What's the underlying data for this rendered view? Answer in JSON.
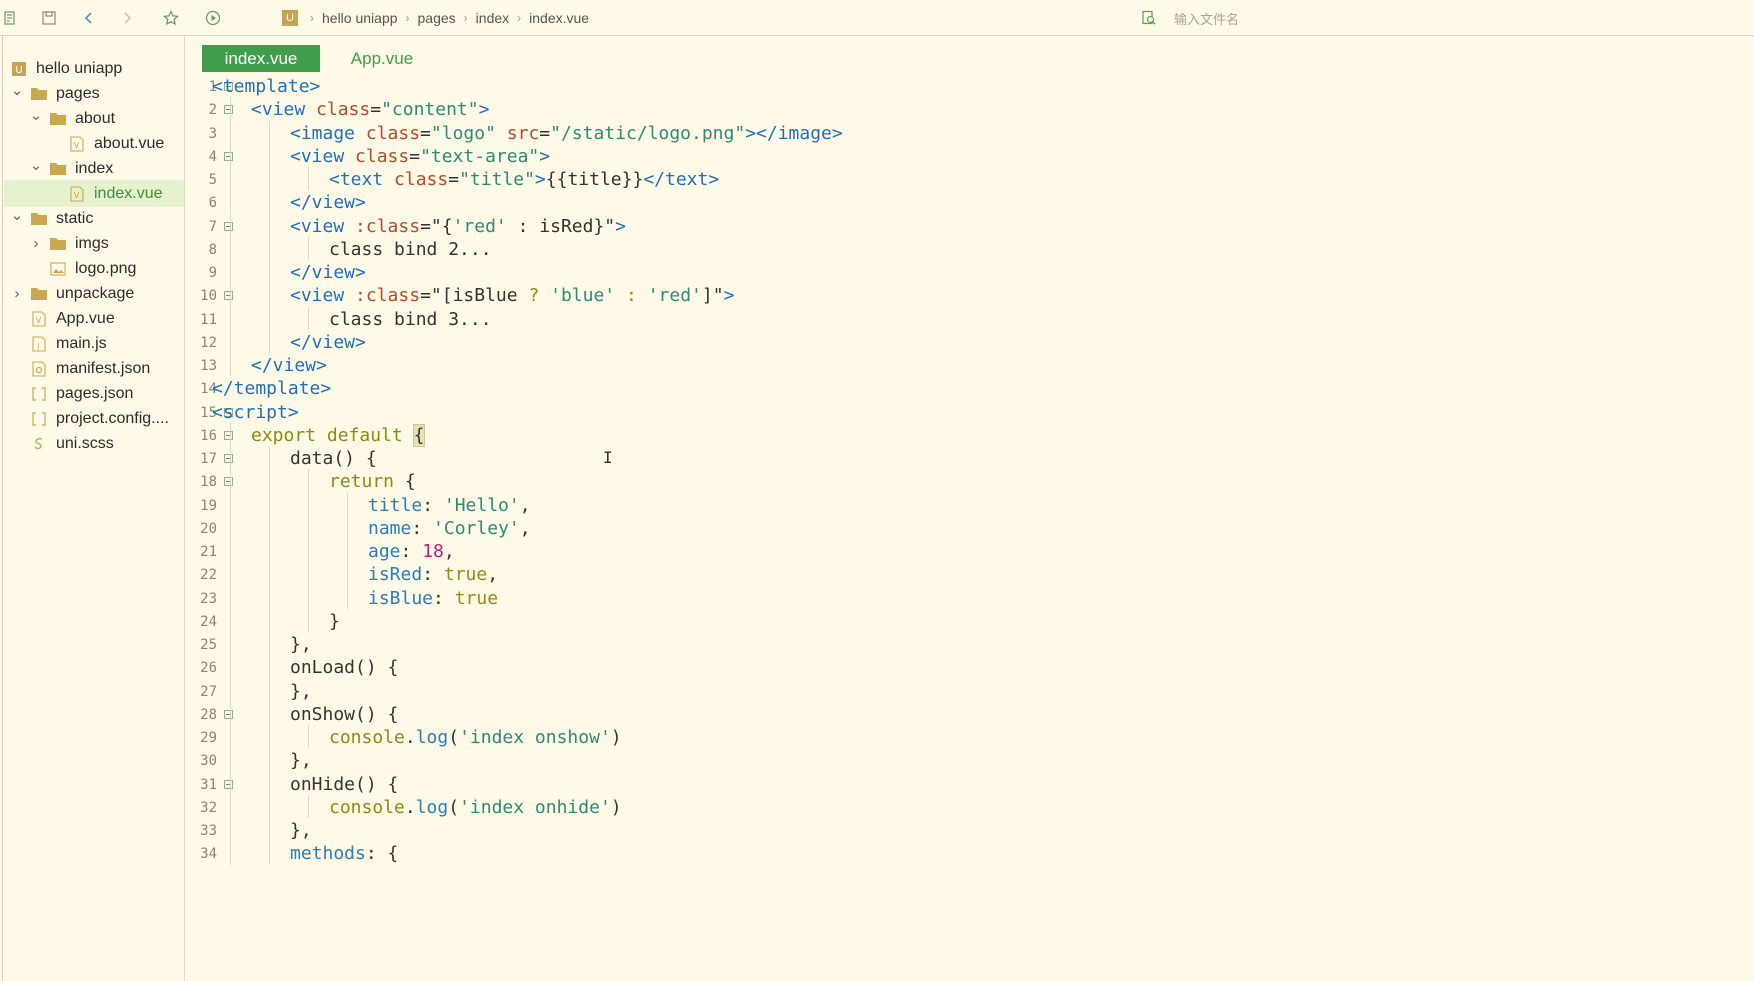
{
  "toolbar": {
    "icons": [
      "app-menu-icon",
      "save-icon",
      "back-icon",
      "forward-icon",
      "star-icon",
      "run-icon"
    ],
    "breadcrumb": {
      "project_icon": "U",
      "items": [
        "hello uniapp",
        "pages",
        "index",
        "index.vue"
      ]
    },
    "file_search": {
      "placeholder": "输入文件名",
      "value": ""
    }
  },
  "sidebar": {
    "items": [
      {
        "label": "hello uniapp",
        "type": "project",
        "level": 0,
        "expanded": true,
        "icon": "project-icon"
      },
      {
        "label": "pages",
        "type": "folder",
        "level": 0,
        "expanded": true,
        "icon": "folder-icon"
      },
      {
        "label": "about",
        "type": "folder",
        "level": 1,
        "expanded": true,
        "icon": "folder-icon"
      },
      {
        "label": "about.vue",
        "type": "vue",
        "level": 2,
        "icon": "vue-file-icon"
      },
      {
        "label": "index",
        "type": "folder",
        "level": 1,
        "expanded": true,
        "icon": "folder-icon"
      },
      {
        "label": "index.vue",
        "type": "vue",
        "level": 2,
        "icon": "vue-file-icon",
        "selected": true
      },
      {
        "label": "static",
        "type": "folder",
        "level": 0,
        "expanded": true,
        "icon": "folder-icon"
      },
      {
        "label": "imgs",
        "type": "folder",
        "level": 1,
        "expanded": false,
        "icon": "folder-icon"
      },
      {
        "label": "logo.png",
        "type": "image",
        "level": 1,
        "icon": "image-file-icon"
      },
      {
        "label": "unpackage",
        "type": "folder",
        "level": 0,
        "expanded": false,
        "icon": "folder-icon"
      },
      {
        "label": "App.vue",
        "type": "vue",
        "level": 0,
        "icon": "vue-file-icon"
      },
      {
        "label": "main.js",
        "type": "js",
        "level": 0,
        "icon": "js-file-icon"
      },
      {
        "label": "manifest.json",
        "type": "json",
        "level": 0,
        "icon": "manifest-file-icon"
      },
      {
        "label": "pages.json",
        "type": "json",
        "level": 0,
        "icon": "json-file-icon"
      },
      {
        "label": "project.config....",
        "type": "json",
        "level": 0,
        "icon": "json-file-icon"
      },
      {
        "label": "uni.scss",
        "type": "scss",
        "level": 0,
        "icon": "scss-file-icon"
      }
    ]
  },
  "tabs": [
    {
      "label": "index.vue",
      "active": true
    },
    {
      "label": "App.vue",
      "active": false
    }
  ],
  "editor": {
    "lines": [
      {
        "n": "1",
        "fold": true,
        "indent": 0,
        "tokens": [
          [
            "tag",
            "<template>"
          ]
        ]
      },
      {
        "n": "2",
        "fold": true,
        "indent": 1,
        "tokens": [
          [
            "tag",
            "<view "
          ],
          [
            "attr",
            "class"
          ],
          [
            "punc",
            "="
          ],
          [
            "str",
            "\"content\""
          ],
          [
            "tag",
            ">"
          ]
        ]
      },
      {
        "n": "3",
        "fold": false,
        "indent": 2,
        "tokens": [
          [
            "tag",
            "<image "
          ],
          [
            "attr",
            "class"
          ],
          [
            "punc",
            "="
          ],
          [
            "str",
            "\"logo\""
          ],
          [
            "punc",
            " "
          ],
          [
            "attr",
            "src"
          ],
          [
            "punc",
            "="
          ],
          [
            "str",
            "\"/static/logo.png\""
          ],
          [
            "tag",
            "></image>"
          ]
        ]
      },
      {
        "n": "4",
        "fold": true,
        "indent": 2,
        "tokens": [
          [
            "tag",
            "<view "
          ],
          [
            "attr",
            "class"
          ],
          [
            "punc",
            "="
          ],
          [
            "str",
            "\"text-area\""
          ],
          [
            "tag",
            ">"
          ]
        ]
      },
      {
        "n": "5",
        "fold": false,
        "indent": 3,
        "tokens": [
          [
            "tag",
            "<text "
          ],
          [
            "attr",
            "class"
          ],
          [
            "punc",
            "="
          ],
          [
            "str",
            "\"title\""
          ],
          [
            "tag",
            ">"
          ],
          [
            "punc",
            "{{title}}"
          ],
          [
            "tag",
            "</text>"
          ]
        ]
      },
      {
        "n": "6",
        "fold": false,
        "indent": 2,
        "tokens": [
          [
            "tag",
            "</view>"
          ]
        ]
      },
      {
        "n": "7",
        "fold": true,
        "indent": 2,
        "tokens": [
          [
            "tag",
            "<view "
          ],
          [
            "attr",
            ":class"
          ],
          [
            "punc",
            "=\"{"
          ],
          [
            "str",
            "'red'"
          ],
          [
            "punc",
            " : isRed}\""
          ],
          [
            "tag",
            ">"
          ]
        ]
      },
      {
        "n": "8",
        "fold": false,
        "indent": 3,
        "tokens": [
          [
            "punc",
            "class bind 2..."
          ]
        ]
      },
      {
        "n": "9",
        "fold": false,
        "indent": 2,
        "tokens": [
          [
            "tag",
            "</view>"
          ]
        ]
      },
      {
        "n": "10",
        "fold": true,
        "indent": 2,
        "tokens": [
          [
            "tag",
            "<view "
          ],
          [
            "attr",
            ":class"
          ],
          [
            "punc",
            "=\"[isBlue "
          ],
          [
            "kw",
            "?"
          ],
          [
            "punc",
            " "
          ],
          [
            "str",
            "'blue'"
          ],
          [
            "punc",
            " "
          ],
          [
            "kw",
            ":"
          ],
          [
            "punc",
            " "
          ],
          [
            "str",
            "'red'"
          ],
          [
            "punc",
            "]\""
          ],
          [
            "tag",
            ">"
          ]
        ]
      },
      {
        "n": "11",
        "fold": false,
        "indent": 3,
        "tokens": [
          [
            "punc",
            "class bind 3..."
          ]
        ]
      },
      {
        "n": "12",
        "fold": false,
        "indent": 2,
        "tokens": [
          [
            "tag",
            "</view>"
          ]
        ]
      },
      {
        "n": "13",
        "fold": false,
        "indent": 1,
        "tokens": [
          [
            "tag",
            "</view>"
          ]
        ]
      },
      {
        "n": "14",
        "fold": false,
        "indent": 0,
        "tokens": [
          [
            "tag",
            "</template>"
          ]
        ]
      },
      {
        "n": "15",
        "fold": true,
        "indent": 0,
        "tokens": [
          [
            "tag",
            "<script>"
          ]
        ]
      },
      {
        "n": "16",
        "fold": true,
        "indent": 1,
        "tokens": [
          [
            "kw",
            "export default "
          ],
          [
            "brace",
            "{"
          ]
        ]
      },
      {
        "n": "17",
        "fold": true,
        "indent": 2,
        "tokens": [
          [
            "punc",
            "data() {"
          ]
        ]
      },
      {
        "n": "18",
        "fold": true,
        "indent": 3,
        "tokens": [
          [
            "kw",
            "return"
          ],
          [
            "punc",
            " {"
          ]
        ]
      },
      {
        "n": "19",
        "fold": false,
        "indent": 4,
        "tokens": [
          [
            "prop",
            "title"
          ],
          [
            "punc",
            ": "
          ],
          [
            "str",
            "'Hello'"
          ],
          [
            "punc",
            ","
          ]
        ]
      },
      {
        "n": "20",
        "fold": false,
        "indent": 4,
        "tokens": [
          [
            "prop",
            "name"
          ],
          [
            "punc",
            ": "
          ],
          [
            "str",
            "'Corley'"
          ],
          [
            "punc",
            ","
          ]
        ]
      },
      {
        "n": "21",
        "fold": false,
        "indent": 4,
        "tokens": [
          [
            "prop",
            "age"
          ],
          [
            "punc",
            ": "
          ],
          [
            "num",
            "18"
          ],
          [
            "punc",
            ","
          ]
        ]
      },
      {
        "n": "22",
        "fold": false,
        "indent": 4,
        "tokens": [
          [
            "prop",
            "isRed"
          ],
          [
            "punc",
            ": "
          ],
          [
            "bool",
            "true"
          ],
          [
            "punc",
            ","
          ]
        ]
      },
      {
        "n": "23",
        "fold": false,
        "indent": 4,
        "tokens": [
          [
            "prop",
            "isBlue"
          ],
          [
            "punc",
            ": "
          ],
          [
            "bool",
            "true"
          ]
        ]
      },
      {
        "n": "24",
        "fold": false,
        "indent": 3,
        "tokens": [
          [
            "punc",
            "}"
          ]
        ]
      },
      {
        "n": "25",
        "fold": false,
        "indent": 2,
        "tokens": [
          [
            "punc",
            "},"
          ]
        ]
      },
      {
        "n": "26",
        "fold": false,
        "indent": 2,
        "tokens": [
          [
            "punc",
            "onLoad() {"
          ]
        ]
      },
      {
        "n": "27",
        "fold": false,
        "indent": 2,
        "tokens": [
          [
            "punc",
            "},"
          ]
        ]
      },
      {
        "n": "28",
        "fold": true,
        "indent": 2,
        "tokens": [
          [
            "punc",
            "onShow() {"
          ]
        ]
      },
      {
        "n": "29",
        "fold": false,
        "indent": 3,
        "tokens": [
          [
            "kw",
            "console"
          ],
          [
            "punc",
            "."
          ],
          [
            "fn",
            "log"
          ],
          [
            "punc",
            "("
          ],
          [
            "str",
            "'index onshow'"
          ],
          [
            "punc",
            ")"
          ]
        ]
      },
      {
        "n": "30",
        "fold": false,
        "indent": 2,
        "tokens": [
          [
            "punc",
            "},"
          ]
        ]
      },
      {
        "n": "31",
        "fold": true,
        "indent": 2,
        "tokens": [
          [
            "punc",
            "onHide() {"
          ]
        ]
      },
      {
        "n": "32",
        "fold": false,
        "indent": 3,
        "tokens": [
          [
            "kw",
            "console"
          ],
          [
            "punc",
            "."
          ],
          [
            "fn",
            "log"
          ],
          [
            "punc",
            "("
          ],
          [
            "str",
            "'index onhide'"
          ],
          [
            "punc",
            ")"
          ]
        ]
      },
      {
        "n": "33",
        "fold": false,
        "indent": 2,
        "tokens": [
          [
            "punc",
            "},"
          ]
        ]
      },
      {
        "n": "34",
        "fold": false,
        "indent": 2,
        "tokens": [
          [
            "prop",
            "methods"
          ],
          [
            "punc",
            ": {"
          ]
        ]
      }
    ]
  },
  "colors": {
    "background": "#fffae8",
    "active_tab": "#3f9d4c",
    "selected_tree_item": "#e6f1cd",
    "tag": "#1f6fbf",
    "attribute": "#b34b2a",
    "string": "#2e8b74",
    "keyword": "#8f8a14",
    "number": "#c9187a"
  }
}
